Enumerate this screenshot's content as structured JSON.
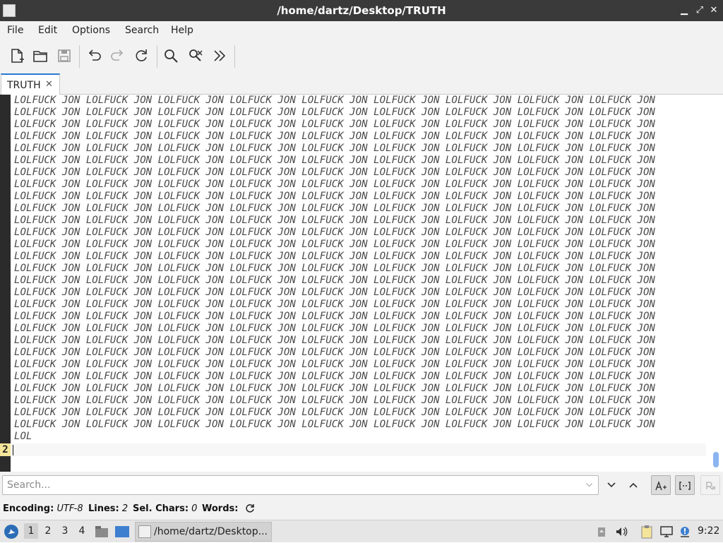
{
  "window": {
    "title": "/home/dartz/Desktop/TRUTH",
    "controls": {
      "minimize": "▁",
      "maximize": "⤢",
      "close": "✕"
    }
  },
  "menubar": {
    "items": [
      "File",
      "Edit",
      "Options",
      "Search",
      "Help"
    ]
  },
  "toolbar": {
    "icons": [
      "new-file-icon",
      "open-file-icon",
      "save-icon",
      "undo-icon",
      "redo-icon",
      "reload-icon",
      "find-icon",
      "replace-icon",
      "more-icon"
    ]
  },
  "tabs": [
    {
      "label": "TRUTH",
      "close": "✕"
    }
  ],
  "editor": {
    "line1": "LOLFUCK JON LOLFUCK JON LOLFUCK JON LOLFUCK JON LOLFUCK JON LOLFUCK JON LOLFUCK JON LOLFUCK JON LOLFUCK JON\nLOLFUCK JON LOLFUCK JON LOLFUCK JON LOLFUCK JON LOLFUCK JON LOLFUCK JON LOLFUCK JON LOLFUCK JON LOLFUCK JON\nLOLFUCK JON LOLFUCK JON LOLFUCK JON LOLFUCK JON LOLFUCK JON LOLFUCK JON LOLFUCK JON LOLFUCK JON LOLFUCK JON\nLOLFUCK JON LOLFUCK JON LOLFUCK JON LOLFUCK JON LOLFUCK JON LOLFUCK JON LOLFUCK JON LOLFUCK JON LOLFUCK JON\nLOLFUCK JON LOLFUCK JON LOLFUCK JON LOLFUCK JON LOLFUCK JON LOLFUCK JON LOLFUCK JON LOLFUCK JON LOLFUCK JON\nLOLFUCK JON LOLFUCK JON LOLFUCK JON LOLFUCK JON LOLFUCK JON LOLFUCK JON LOLFUCK JON LOLFUCK JON LOLFUCK JON\nLOLFUCK JON LOLFUCK JON LOLFUCK JON LOLFUCK JON LOLFUCK JON LOLFUCK JON LOLFUCK JON LOLFUCK JON LOLFUCK JON\nLOLFUCK JON LOLFUCK JON LOLFUCK JON LOLFUCK JON LOLFUCK JON LOLFUCK JON LOLFUCK JON LOLFUCK JON LOLFUCK JON\nLOLFUCK JON LOLFUCK JON LOLFUCK JON LOLFUCK JON LOLFUCK JON LOLFUCK JON LOLFUCK JON LOLFUCK JON LOLFUCK JON\nLOLFUCK JON LOLFUCK JON LOLFUCK JON LOLFUCK JON LOLFUCK JON LOLFUCK JON LOLFUCK JON LOLFUCK JON LOLFUCK JON\nLOLFUCK JON LOLFUCK JON LOLFUCK JON LOLFUCK JON LOLFUCK JON LOLFUCK JON LOLFUCK JON LOLFUCK JON LOLFUCK JON\nLOLFUCK JON LOLFUCK JON LOLFUCK JON LOLFUCK JON LOLFUCK JON LOLFUCK JON LOLFUCK JON LOLFUCK JON LOLFUCK JON\nLOLFUCK JON LOLFUCK JON LOLFUCK JON LOLFUCK JON LOLFUCK JON LOLFUCK JON LOLFUCK JON LOLFUCK JON LOLFUCK JON\nLOLFUCK JON LOLFUCK JON LOLFUCK JON LOLFUCK JON LOLFUCK JON LOLFUCK JON LOLFUCK JON LOLFUCK JON LOLFUCK JON\nLOLFUCK JON LOLFUCK JON LOLFUCK JON LOLFUCK JON LOLFUCK JON LOLFUCK JON LOLFUCK JON LOLFUCK JON LOLFUCK JON\nLOLFUCK JON LOLFUCK JON LOLFUCK JON LOLFUCK JON LOLFUCK JON LOLFUCK JON LOLFUCK JON LOLFUCK JON LOLFUCK JON\nLOLFUCK JON LOLFUCK JON LOLFUCK JON LOLFUCK JON LOLFUCK JON LOLFUCK JON LOLFUCK JON LOLFUCK JON LOLFUCK JON\nLOLFUCK JON LOLFUCK JON LOLFUCK JON LOLFUCK JON LOLFUCK JON LOLFUCK JON LOLFUCK JON LOLFUCK JON LOLFUCK JON\nLOLFUCK JON LOLFUCK JON LOLFUCK JON LOLFUCK JON LOLFUCK JON LOLFUCK JON LOLFUCK JON LOLFUCK JON LOLFUCK JON\nLOLFUCK JON LOLFUCK JON LOLFUCK JON LOLFUCK JON LOLFUCK JON LOLFUCK JON LOLFUCK JON LOLFUCK JON LOLFUCK JON\nLOLFUCK JON LOLFUCK JON LOLFUCK JON LOLFUCK JON LOLFUCK JON LOLFUCK JON LOLFUCK JON LOLFUCK JON LOLFUCK JON\nLOLFUCK JON LOLFUCK JON LOLFUCK JON LOLFUCK JON LOLFUCK JON LOLFUCK JON LOLFUCK JON LOLFUCK JON LOLFUCK JON\nLOLFUCK JON LOLFUCK JON LOLFUCK JON LOLFUCK JON LOLFUCK JON LOLFUCK JON LOLFUCK JON LOLFUCK JON LOLFUCK JON\nLOLFUCK JON LOLFUCK JON LOLFUCK JON LOLFUCK JON LOLFUCK JON LOLFUCK JON LOLFUCK JON LOLFUCK JON LOLFUCK JON\nLOLFUCK JON LOLFUCK JON LOLFUCK JON LOLFUCK JON LOLFUCK JON LOLFUCK JON LOLFUCK JON LOLFUCK JON LOLFUCK JON\nLOLFUCK JON LOLFUCK JON LOLFUCK JON LOLFUCK JON LOLFUCK JON LOLFUCK JON LOLFUCK JON LOLFUCK JON LOLFUCK JON\nLOLFUCK JON LOLFUCK JON LOLFUCK JON LOLFUCK JON LOLFUCK JON LOLFUCK JON LOLFUCK JON LOLFUCK JON LOLFUCK JON\nLOLFUCK JON LOLFUCK JON LOLFUCK JON LOLFUCK JON LOLFUCK JON LOLFUCK JON LOLFUCK JON LOLFUCK JON LOLFUCK JON\nLOL",
    "current_line_number": "2"
  },
  "search": {
    "placeholder": "Search..."
  },
  "status": {
    "encoding_label": "Encoding:",
    "encoding_value": "UTF-8",
    "lines_label": "Lines:",
    "lines_value": "2",
    "selchars_label": "Sel. Chars:",
    "selchars_value": "0",
    "words_label": "Words:"
  },
  "taskbar": {
    "desktops": [
      "1",
      "2",
      "3",
      "4"
    ],
    "task_title": "/home/dartz/Desktop...",
    "clock": "9:22"
  },
  "colors": {
    "accent": "#2b7ad4",
    "gutter": "#2b2b2b",
    "current_line_number_bg": "#f5e59a"
  }
}
